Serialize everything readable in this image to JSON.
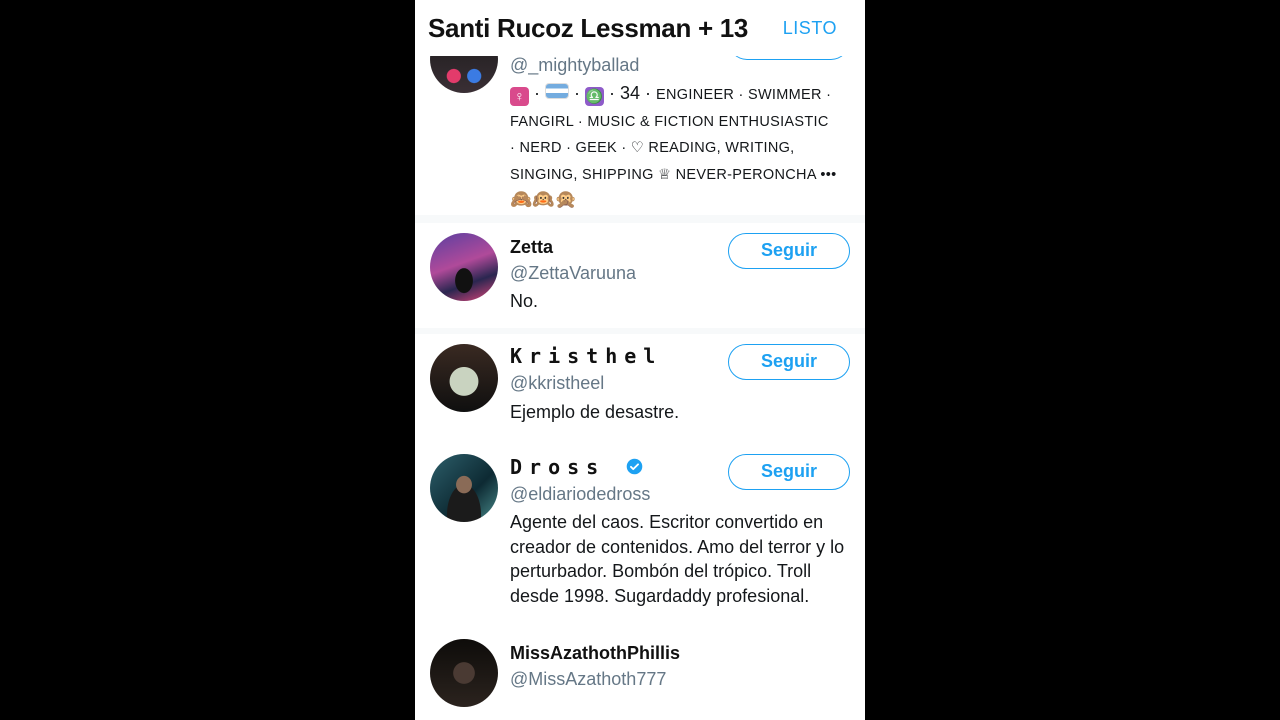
{
  "header": {
    "title": "Santi Rucoz Lessman + 13",
    "done_label": "LISTO"
  },
  "users": [
    {
      "handle": "@_mightyballad",
      "bio_line1": "· 34 ·",
      "bio_tags1": "ENGINEER · SWIMMER ·",
      "bio_line2": "FANGIRL · MUSIC & FICTION ENTHUSIASTIC",
      "bio_line3": "· NERD · GEEK · ♡ READING, WRITING,",
      "bio_line4": "SINGING, SHIPPING ♕ NEVER-PERONCHA •••",
      "bio_emojis": "🙈🙉🙊",
      "icons": [
        "female-sign-icon",
        "argentina-flag-icon",
        "libra-icon"
      ]
    },
    {
      "name": "Zetta",
      "handle": "@ZettaVaruuna",
      "bio": "No.",
      "follow_label": "Seguir"
    },
    {
      "name": "Kristhel",
      "handle": "@kkristheel",
      "bio": "Ejemplo de desastre.",
      "follow_label": "Seguir"
    },
    {
      "name": "Dross",
      "handle": "@eldiariodedross",
      "bio": "Agente del caos. Escritor convertido en creador de contenidos. Amo del terror y lo perturbador. Bombón del trópico. Troll desde 1998. Sugardaddy profesional.",
      "follow_label": "Seguir",
      "verified": true
    },
    {
      "name": "MissAzathothPhillis",
      "handle": "@MissAzathoth777"
    }
  ],
  "colors": {
    "accent": "#1da1f2",
    "handle": "#657786",
    "text": "#14171a"
  }
}
